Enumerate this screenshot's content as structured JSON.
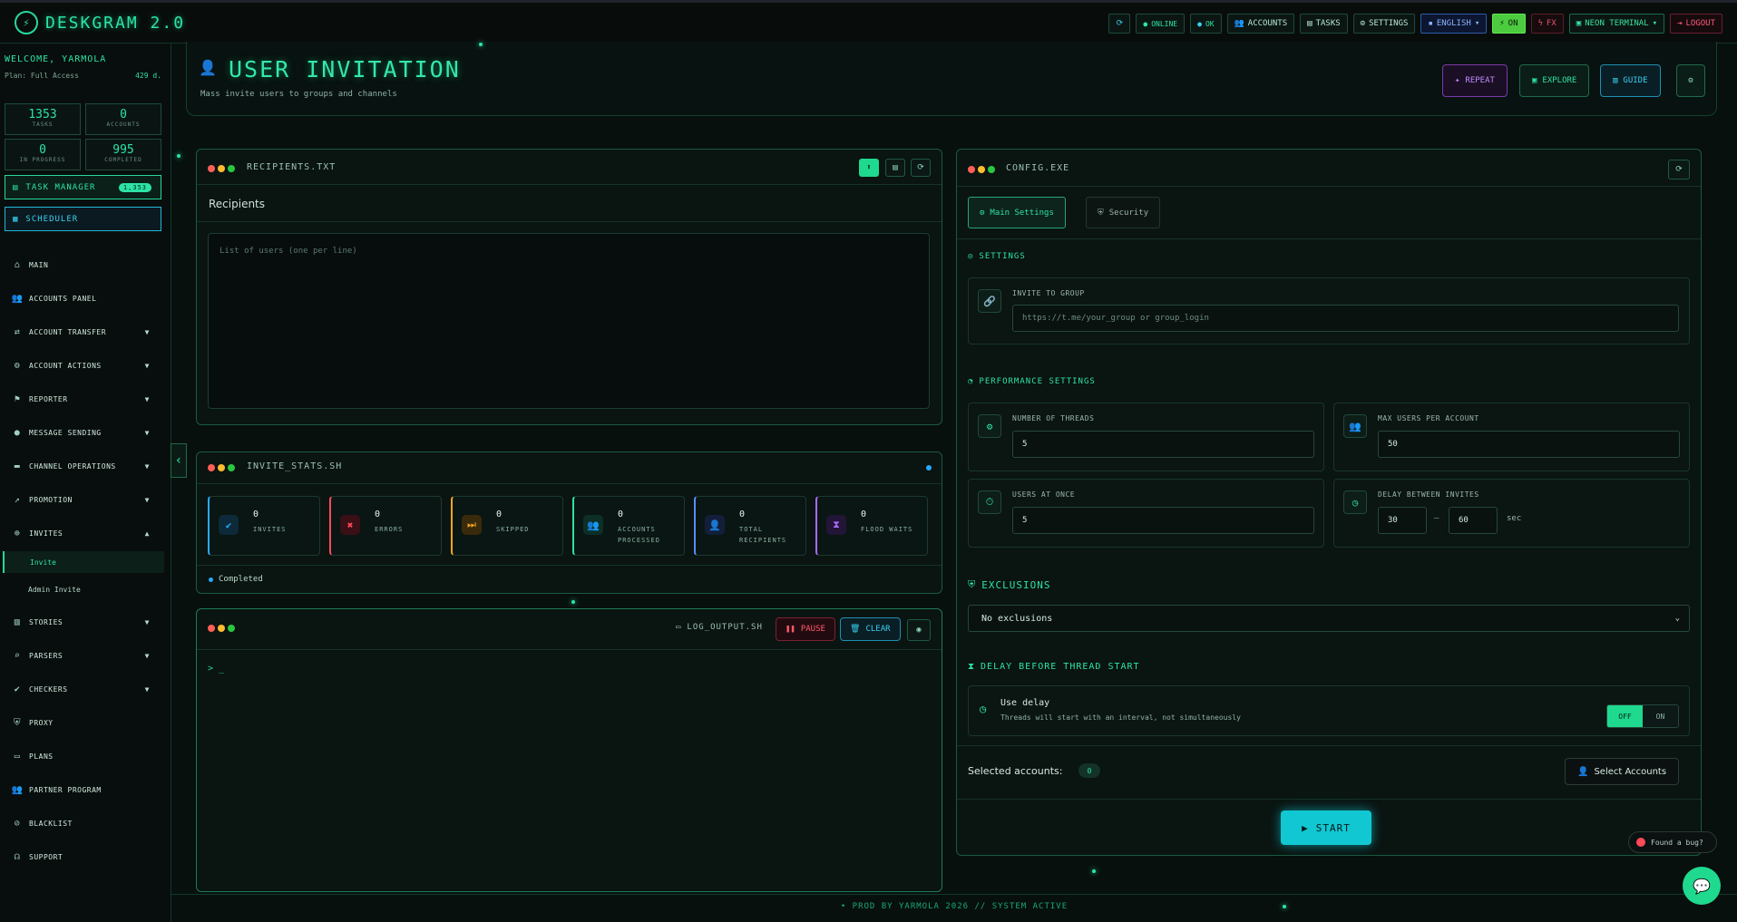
{
  "app": {
    "title": "DESKGRAM 2.0"
  },
  "topnav": {
    "refresh_icon": "refresh-icon",
    "online": "ONLINE",
    "ok": "OK",
    "accounts": "ACCOUNTS",
    "tasks": "TASKS",
    "settings": "SETTINGS",
    "language": "ENGLISH",
    "on": "ON",
    "fx": "FX",
    "theme": "NEON TERMINAL",
    "logout": "LOGOUT"
  },
  "sidebar": {
    "welcome": "WELCOME, YARMOLA",
    "plan": "Plan: Full Access",
    "days": "429 d.",
    "stats": [
      {
        "value": "1353",
        "label": "TASKS"
      },
      {
        "value": "0",
        "label": "ACCOUNTS"
      },
      {
        "value": "0",
        "label": "IN PROGRESS"
      },
      {
        "value": "995",
        "label": "COMPLETED"
      }
    ],
    "task_manager": "TASK MANAGER",
    "task_badge": "1,353",
    "scheduler": "SCHEDULER",
    "items": [
      {
        "label": "MAIN",
        "icon": "home-icon"
      },
      {
        "label": "ACCOUNTS PANEL",
        "icon": "users-icon"
      },
      {
        "label": "ACCOUNT TRANSFER",
        "icon": "transfer-icon"
      },
      {
        "label": "ACCOUNT ACTIONS",
        "icon": "user-gear-icon"
      },
      {
        "label": "REPORTER",
        "icon": "flag-icon"
      },
      {
        "label": "MESSAGE SENDING",
        "icon": "chat-icon"
      },
      {
        "label": "CHANNEL OPERATIONS",
        "icon": "channel-icon"
      },
      {
        "label": "PROMOTION",
        "icon": "chart-icon"
      },
      {
        "label": "INVITES",
        "icon": "invite-icon"
      },
      {
        "label": "STORIES",
        "icon": "stories-icon"
      },
      {
        "label": "PARSERS",
        "icon": "search-icon"
      },
      {
        "label": "CHECKERS",
        "icon": "check-icon"
      },
      {
        "label": "PROXY",
        "icon": "shield-icon"
      },
      {
        "label": "PLANS",
        "icon": "card-icon"
      },
      {
        "label": "PARTNER PROGRAM",
        "icon": "partner-icon"
      },
      {
        "label": "BLACKLIST",
        "icon": "block-icon"
      },
      {
        "label": "SUPPORT",
        "icon": "headset-icon"
      }
    ],
    "subitems": [
      {
        "label": "Invite"
      },
      {
        "label": "Admin Invite"
      }
    ]
  },
  "header": {
    "title": "USER INVITATION",
    "subtitle": "Mass invite users to groups and channels",
    "repeat": "REPEAT",
    "explore": "EXPLORE",
    "guide": "GUIDE"
  },
  "recipients": {
    "window": "RECIPIENTS.TXT",
    "label": "Recipients",
    "placeholder": "List of users (one per line)"
  },
  "stats": {
    "window": "INVITE_STATS.SH",
    "status": "Completed",
    "cards": [
      {
        "value": "0",
        "label": "INVITES",
        "color": "#27a9ff"
      },
      {
        "value": "0",
        "label": "ERRORS",
        "color": "#ff4a5a"
      },
      {
        "value": "0",
        "label": "SKIPPED",
        "color": "#f5a623"
      },
      {
        "value": "0",
        "label": "ACCOUNTS PROCESSED",
        "color": "#2de3a6"
      },
      {
        "value": "0",
        "label": "TOTAL RECIPIENTS",
        "color": "#5b8cff"
      },
      {
        "value": "0",
        "label": "FLOOD WAITS",
        "color": "#a86bff"
      }
    ]
  },
  "log": {
    "window": "LOG_OUTPUT.SH",
    "pause": "PAUSE",
    "clear": "CLEAR",
    "prompt": "> _"
  },
  "config": {
    "window": "CONFIG.EXE",
    "tab_main": "Main Settings",
    "tab_security": "Security",
    "settings_title": "SETTINGS",
    "invite_label": "INVITE TO GROUP",
    "invite_placeholder": "https://t.me/your_group or group_login",
    "perf_title": "PERFORMANCE SETTINGS",
    "threads_label": "NUMBER OF THREADS",
    "threads": "5",
    "max_users_label": "MAX USERS PER ACCOUNT",
    "max_users": "50",
    "users_once_label": "USERS AT ONCE",
    "users_once": "5",
    "delay_label": "DELAY BETWEEN INVITES",
    "delay_from": "30",
    "delay_sep": "—",
    "delay_to": "60",
    "delay_unit": "sec",
    "exclusions_title": "EXCLUSIONS",
    "exclusions_value": "No exclusions",
    "thread_delay_title": "DELAY BEFORE THREAD START",
    "use_delay": "Use delay",
    "use_delay_desc": "Threads will start with an interval, not simultaneously",
    "off": "OFF",
    "on": "ON",
    "selected_label": "Selected accounts:",
    "selected_count": "0",
    "select_btn": "Select Accounts",
    "start": "START"
  },
  "footer": {
    "text": "• PROD BY YARMOLA 2026   // SYSTEM ACTIVE"
  },
  "bug": {
    "label": "Found a bug?"
  },
  "colors": {
    "accent": "#2de3a6",
    "cyan": "#11c7d2",
    "bg": "#07100d"
  }
}
